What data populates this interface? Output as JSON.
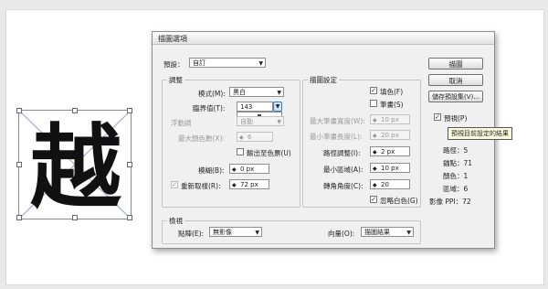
{
  "canvas": {
    "glyph": "越"
  },
  "dialog": {
    "title": "描圖選項",
    "preset_label": "預設：",
    "preset_value": "自訂",
    "buttons": {
      "trace": "描圖",
      "cancel": "取消",
      "save_preset": "儲存預設集(V)..."
    },
    "preview_label": "預視(P)",
    "preview_checked": true,
    "tooltip": "預視目前設定的結果",
    "stats": [
      {
        "label": "路徑：",
        "value": "5"
      },
      {
        "label": "錨點：",
        "value": "71"
      },
      {
        "label": "顏色：",
        "value": "1"
      },
      {
        "label": "區域：",
        "value": "6"
      },
      {
        "label": "影像 PPI：",
        "value": "72"
      }
    ],
    "adjust": {
      "title": "調整",
      "mode_label": "模式(M):",
      "mode_value": "黑白",
      "threshold_label": "臨界值(T):",
      "threshold_value": "143",
      "palette_label": "浮動調",
      "palette_value": "自動",
      "max_colors_label": "最大顏色數(X):",
      "max_colors_value": "6",
      "output_swatches_label": "輸出至色票(U)",
      "blur_label": "模糊(B):",
      "blur_value": "0 px",
      "resample_label": "重新取樣(R):",
      "resample_value": "72 px",
      "resample_checked": true
    },
    "trace": {
      "title": "描圖設定",
      "fills_label": "填色(F)",
      "fills_checked": true,
      "strokes_label": "筆畫(S)",
      "strokes_checked": false,
      "max_stroke_width_label": "最大筆畫寬度(W):",
      "max_stroke_width_value": "10 px",
      "min_stroke_length_label": "最小筆畫長度(L):",
      "min_stroke_length_value": "20 px",
      "path_fitting_label": "路徑調整(I):",
      "path_fitting_value": "2 px",
      "min_area_label": "最小區域(A):",
      "min_area_value": "10 px",
      "corner_angle_label": "轉角角度(C):",
      "corner_angle_value": "20",
      "ignore_white_label": "忽略白色(G)",
      "ignore_white_checked": true
    },
    "view": {
      "title": "檢視",
      "raster_label": "點陣(E):",
      "raster_value": "無影像",
      "vector_label": "向量(O):",
      "vector_value": "描圖結果"
    }
  }
}
